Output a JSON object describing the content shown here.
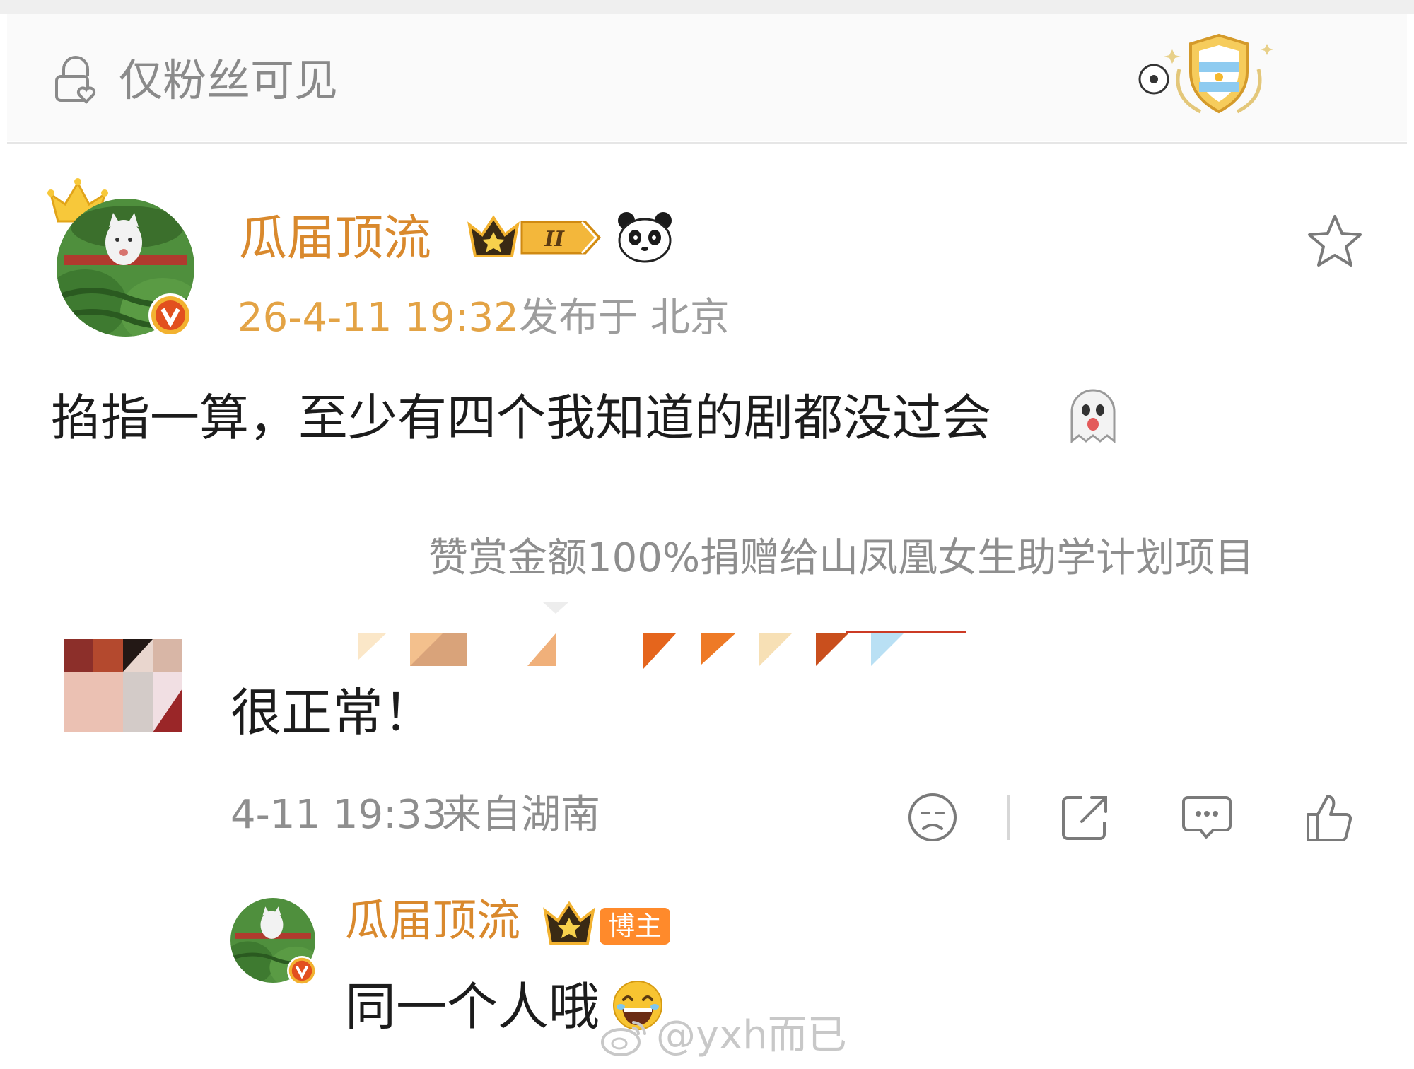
{
  "visibility": {
    "label": "仅粉丝可见",
    "icon": "lock-heart-icon",
    "badge_icon": "argentina-football-badge-icon"
  },
  "post": {
    "author_name": "瓜届顶流",
    "vip_badge_icon": "crown-vip-level-badge-icon",
    "vip_level": "II",
    "emoji_icon": "panda-icon",
    "time": "26-4-11 19:32",
    "location": "发布于 北京",
    "text": "掐指一算，至少有四个我知道的剧都没过会",
    "text_emoji": "ghost-emoji-icon",
    "favorite_icon": "star-icon",
    "donation_note": "赞赏金额100%捐赠给山凤凰女生助学计划项目"
  },
  "comment": {
    "text": "很正常！",
    "time": "4-11 19:33",
    "location": "来自湖南",
    "actions": [
      "dislike-face-icon",
      "share-icon",
      "comment-icon",
      "like-thumb-icon"
    ]
  },
  "reply": {
    "author_name": "瓜届顶流",
    "author_tag": "博主",
    "text": "同一个人哦",
    "text_emoji": "laughing-emoji-icon"
  },
  "watermark": {
    "text": "@yxh而已"
  },
  "colors": {
    "name": "#d9892d",
    "time": "#e3a345",
    "muted": "#8e8e8e",
    "author_tag": "#ff8a2b"
  }
}
